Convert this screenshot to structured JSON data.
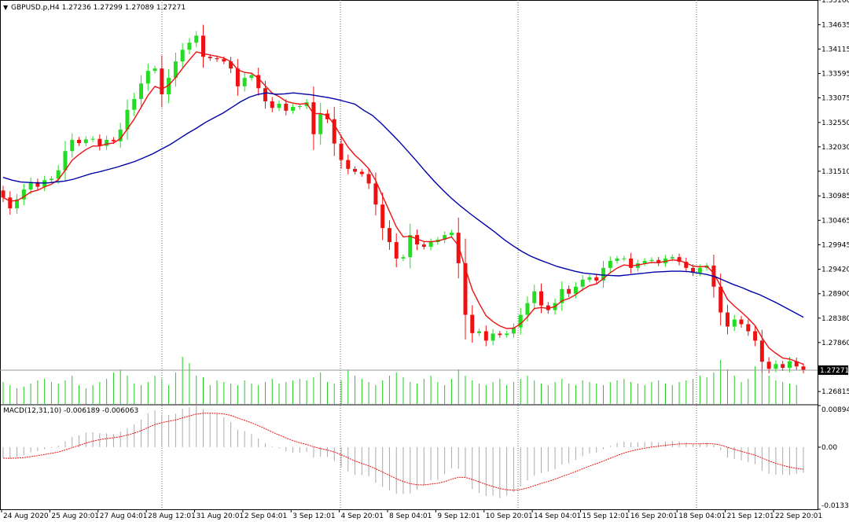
{
  "window": {
    "header_arrow": "▼",
    "header_label": "GBPUSD.p,H4  1.27236 1.27299 1.27089 1.27271"
  },
  "colors": {
    "bull": "#22dd22",
    "bear": "#ee1111",
    "ma_fast": "#ee1111",
    "ma_slow": "#0000aa",
    "volume": "#22cc22",
    "macd_hist": "#aaaaaa",
    "macd_signal": "#ee1111",
    "grid_vertical": "#666666",
    "current_price_line": "#999999",
    "price_tag_bg": "#000000"
  },
  "chart_data": [
    {
      "type": "candlestick",
      "symbol": "GBPUSD.p",
      "timeframe": "H4",
      "ohlc_last": {
        "open": 1.27236,
        "high": 1.27299,
        "low": 1.27089,
        "close": 1.27271
      },
      "ylim": [
        1.2655,
        1.3516
      ],
      "y_ticks": [
        "1.35160",
        "1.34635",
        "1.34115",
        "1.33595",
        "1.33075",
        "1.32550",
        "1.32030",
        "1.31510",
        "1.30985",
        "1.30465",
        "1.29945",
        "1.29420",
        "1.28900",
        "1.28380",
        "1.27860",
        "1.27271",
        "1.26815"
      ],
      "current_price": 1.27271,
      "current_price_label": "1.27271",
      "x_labels": [
        "24 Aug 2020",
        "25 Aug 20:01",
        "27 Aug 04:01",
        "28 Aug 12:01",
        "31 Aug 20:01",
        "2 Sep 04:01",
        "3 Sep 12:01",
        "4 Sep 20:01",
        "8 Sep 04:01",
        "9 Sep 12:01",
        "10 Sep 20:01",
        "14 Sep 04:01",
        "15 Sep 12:01",
        "16 Sep 20:01",
        "18 Sep 04:01",
        "21 Sep 12:01",
        "22 Sep 20:01"
      ],
      "close_series": [
        1.3095,
        1.3072,
        1.3091,
        1.3112,
        1.3128,
        1.3118,
        1.3132,
        1.3135,
        1.3153,
        1.3194,
        1.3218,
        1.3211,
        1.3219,
        1.322,
        1.3205,
        1.3218,
        1.3215,
        1.324,
        1.3282,
        1.3305,
        1.3338,
        1.3365,
        1.337,
        1.3315,
        1.335,
        1.3385,
        1.341,
        1.3425,
        1.344,
        1.3395,
        1.3392,
        1.339,
        1.3385,
        1.337,
        1.3332,
        1.335,
        1.3356,
        1.3328,
        1.33,
        1.3286,
        1.3295,
        1.328,
        1.3288,
        1.329,
        1.3298,
        1.323,
        1.3274,
        1.3262,
        1.321,
        1.3175,
        1.3156,
        1.315,
        1.3145,
        1.3125,
        1.308,
        1.303,
        1.3,
        1.2965,
        1.2968,
        1.3015,
        1.2995,
        1.299,
        1.3,
        1.3005,
        1.3015,
        1.302,
        1.2955,
        1.2845,
        1.2806,
        1.281,
        1.279,
        1.2805,
        1.2802,
        1.2805,
        1.2818,
        1.2845,
        1.287,
        1.2895,
        1.2865,
        1.2855,
        1.287,
        1.29,
        1.289,
        1.2905,
        1.292,
        1.2925,
        1.2918,
        1.2945,
        1.296,
        1.2965,
        1.2965,
        1.2945,
        1.2955,
        1.296,
        1.2962,
        1.2955,
        1.2965,
        1.2968,
        1.2958,
        1.2945,
        1.2935,
        1.2945,
        1.295,
        1.2905,
        1.285,
        1.282,
        1.2835,
        1.2825,
        1.281,
        1.279,
        1.2745,
        1.273,
        1.274,
        1.2732,
        1.2746,
        1.2735,
        1.2727
      ],
      "ma_fast_period_label": "",
      "ma_slow_series": [
        1.3138,
        1.3132,
        1.3128,
        1.3127,
        1.3126,
        1.3126,
        1.3128,
        1.313,
        1.3134,
        1.314,
        1.3146,
        1.315,
        1.3155,
        1.316,
        1.3166,
        1.3172,
        1.318,
        1.3188,
        1.3198,
        1.3208,
        1.322,
        1.3232,
        1.3243,
        1.3255,
        1.3265,
        1.3275,
        1.3287,
        1.3299,
        1.3309,
        1.3315,
        1.3318,
        1.3315,
        1.3316,
        1.3318,
        1.3316,
        1.3314,
        1.3311,
        1.3308,
        1.3304,
        1.3299,
        1.3294,
        1.3281,
        1.327,
        1.3253,
        1.3234,
        1.3215,
        1.3194,
        1.3173,
        1.3151,
        1.313,
        1.3111,
        1.3093,
        1.3077,
        1.3062,
        1.3048,
        1.3034,
        1.302,
        1.3005,
        1.2992,
        1.298,
        1.297,
        1.2962,
        1.2955,
        1.2948,
        1.2943,
        1.2938,
        1.2934,
        1.2932,
        1.293,
        1.2929,
        1.2928,
        1.293,
        1.2932,
        1.2934,
        1.2936,
        1.2937,
        1.2938,
        1.2938,
        1.2937,
        1.2934,
        1.2931,
        1.2926,
        1.2918,
        1.291,
        1.2903,
        1.2895,
        1.2888,
        1.2879,
        1.287,
        1.286,
        1.285,
        1.284
      ],
      "volume": [
        14,
        12,
        10,
        11,
        13,
        15,
        16,
        14,
        13,
        15,
        18,
        12,
        10,
        12,
        14,
        16,
        20,
        22,
        18,
        13,
        12,
        14,
        18,
        16,
        12,
        20,
        30,
        26,
        18,
        17,
        12,
        15,
        14,
        13,
        12,
        15,
        13,
        12,
        14,
        16,
        13,
        14,
        15,
        16,
        15,
        17,
        20,
        14,
        13,
        15,
        22,
        18,
        16,
        14,
        12,
        15,
        18,
        20,
        17,
        14,
        13,
        16,
        18,
        14,
        12,
        16,
        22,
        18,
        15,
        13,
        12,
        14,
        16,
        12,
        14,
        16,
        18,
        15,
        13,
        12,
        14,
        16,
        13,
        12,
        15,
        14,
        13,
        12,
        14,
        15,
        16,
        14,
        13,
        12,
        14,
        15,
        13,
        12,
        14,
        15,
        16,
        18,
        17,
        20,
        28,
        22,
        18,
        14,
        16,
        24,
        20,
        18,
        15,
        14,
        13,
        12
      ],
      "volume_max": 30,
      "macd": {
        "label": "MACD(12,31,10) -0.006189 -0.006063",
        "ylim": [
          -0.013347,
          0.008948
        ],
        "y_ticks": [
          "0.008948",
          "0.00",
          "-0.013347"
        ]
      }
    }
  ]
}
